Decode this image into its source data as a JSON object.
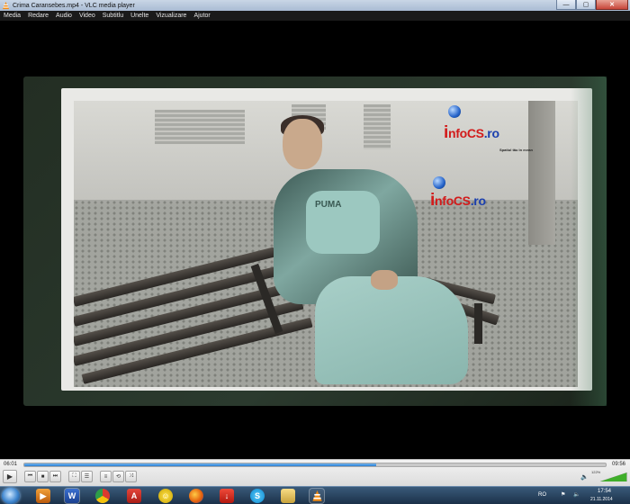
{
  "window": {
    "title": "Crima Caransebes.mp4 - VLC media player",
    "minimize": "—",
    "maximize": "▢",
    "close": "✕"
  },
  "menu": [
    "Media",
    "Redare",
    "Audio",
    "Video",
    "Subtitlu",
    "Unelte",
    "Vizualizare",
    "Ajutor"
  ],
  "video": {
    "logo1_text_info": "nfoCS",
    "logo1_text_ro": ".ro",
    "logo1_tagline": "Spatiul tău în ecran",
    "logo2_text_info": "nfoCS",
    "logo2_text_ro": ".ro",
    "shirt_text": "PUMA"
  },
  "player": {
    "elapsed": "06:01",
    "total": "09:56",
    "progress": 0.605,
    "volume_label": "122%",
    "volume_level": 1.22
  },
  "controls": {
    "play": "▶",
    "prev": "⏮",
    "stop": "■",
    "next": "⏭",
    "fullscreen": "⛶",
    "extended": "☰",
    "playlist": "≡",
    "loop": "⟲",
    "random": "⤨"
  },
  "taskbar": {
    "language": "RO",
    "time": "17:54",
    "date": "21.11.2014",
    "icons": [
      "media-player-icon",
      "word-icon",
      "chrome-icon",
      "pdf-icon",
      "yahoo-messenger-icon",
      "firefox-icon",
      "download-manager-icon",
      "skype-icon",
      "file-explorer-icon",
      "vlc-icon"
    ]
  }
}
